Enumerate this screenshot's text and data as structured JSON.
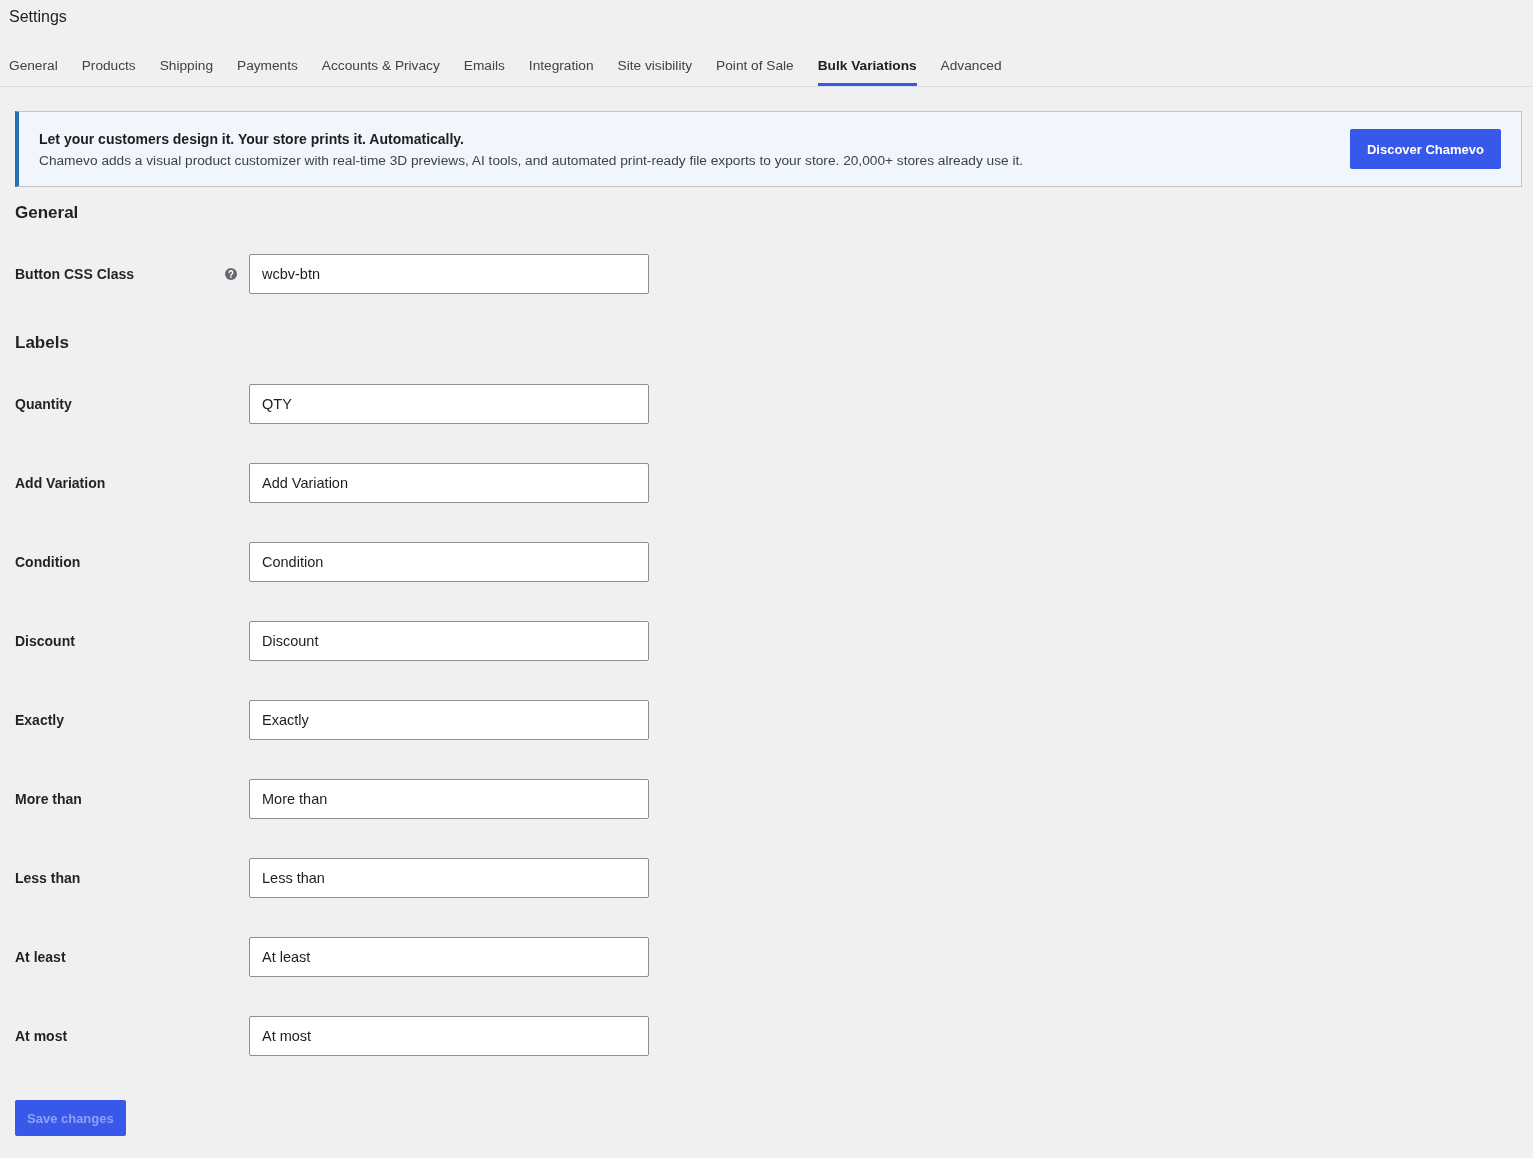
{
  "title": "Settings",
  "tabs": [
    {
      "label": "General",
      "selected": false
    },
    {
      "label": "Products",
      "selected": false
    },
    {
      "label": "Shipping",
      "selected": false
    },
    {
      "label": "Payments",
      "selected": false
    },
    {
      "label": "Accounts & Privacy",
      "selected": false
    },
    {
      "label": "Emails",
      "selected": false
    },
    {
      "label": "Integration",
      "selected": false
    },
    {
      "label": "Site visibility",
      "selected": false
    },
    {
      "label": "Point of Sale",
      "selected": false
    },
    {
      "label": "Bulk Variations",
      "selected": true
    },
    {
      "label": "Advanced",
      "selected": false
    }
  ],
  "banner": {
    "heading": "Let your customers design it. Your store prints it. Automatically.",
    "text": "Chamevo adds a visual product customizer with real-time 3D previews, AI tools, and automated print-ready file exports to your store. 20,000+ stores already use it.",
    "button": "Discover Chamevo"
  },
  "sections": [
    {
      "title": "General",
      "fields": [
        {
          "label": "Button CSS Class",
          "value": "wcbv-btn",
          "help": true
        }
      ]
    },
    {
      "title": "Labels",
      "fields": [
        {
          "label": "Quantity",
          "value": "QTY",
          "help": false
        },
        {
          "label": "Add Variation",
          "value": "Add Variation",
          "help": false
        },
        {
          "label": "Condition",
          "value": "Condition",
          "help": false
        },
        {
          "label": "Discount",
          "value": "Discount",
          "help": false
        },
        {
          "label": "Exactly",
          "value": "Exactly",
          "help": false
        },
        {
          "label": "More than",
          "value": "More than",
          "help": false
        },
        {
          "label": "Less than",
          "value": "Less than",
          "help": false
        },
        {
          "label": "At least",
          "value": "At least",
          "help": false
        },
        {
          "label": "At most",
          "value": "At most",
          "help": false
        }
      ]
    }
  ],
  "save_button": {
    "label": "Save changes",
    "disabled": true
  }
}
